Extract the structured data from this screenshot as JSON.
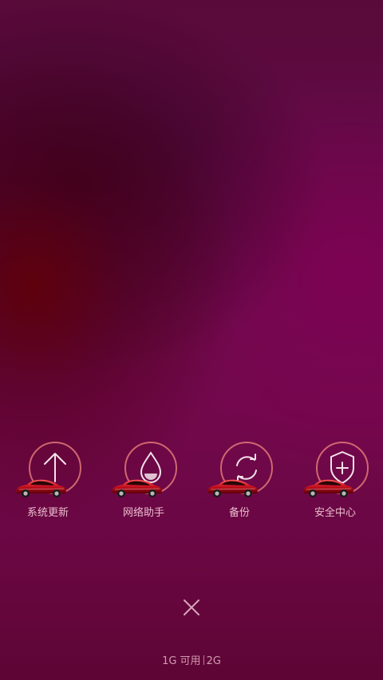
{
  "tools": [
    {
      "label": "系统更新",
      "icon": "arrow-up-icon"
    },
    {
      "label": "网络助手",
      "icon": "water-drop-icon"
    },
    {
      "label": "备份",
      "icon": "sync-icon"
    },
    {
      "label": "安全中心",
      "icon": "shield-plus-icon"
    }
  ],
  "memory": {
    "available": "1G 可用",
    "total": "2G"
  },
  "close_icon": "close-icon",
  "colors": {
    "ring": "#e17878",
    "label": "#ffdce6",
    "background_top": "#5a0a3a",
    "background_bottom": "#5e0535"
  }
}
